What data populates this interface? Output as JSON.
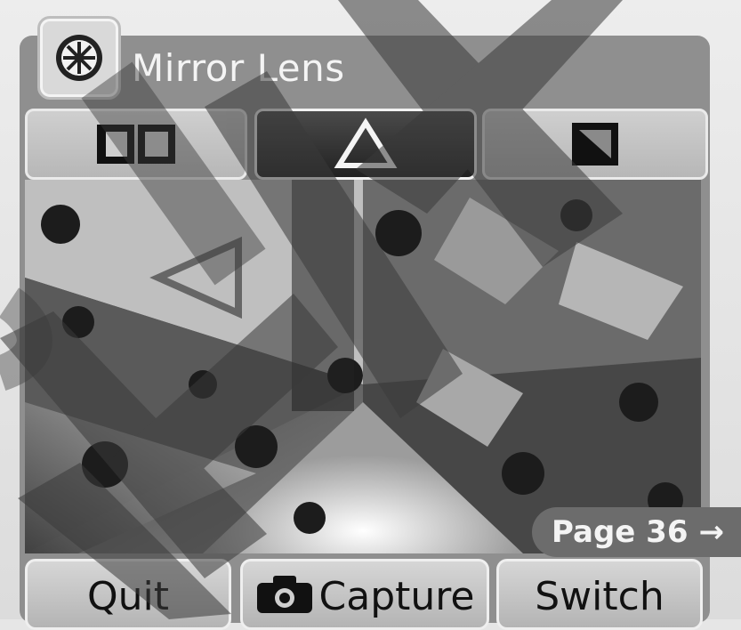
{
  "app": {
    "title": "Mirror Lens",
    "icon": "mirror-lens-icon"
  },
  "lens_modes": [
    {
      "name": "split",
      "icon": "split-mirror-icon",
      "selected": false
    },
    {
      "name": "triangle",
      "icon": "triangle-mirror-icon",
      "selected": true
    },
    {
      "name": "square",
      "icon": "square-mirror-icon",
      "selected": false
    }
  ],
  "page_tag": {
    "label": "Page 36",
    "arrow": "→"
  },
  "bottom_bar": {
    "quit": "Quit",
    "capture": "Capture",
    "switch": "Switch"
  },
  "colors": {
    "frame": "#8f8f8f",
    "button": "#c8c8c8",
    "active_button": "#2a2a2a",
    "page_tag": "#6c6c6c",
    "overlay": "#555555"
  }
}
